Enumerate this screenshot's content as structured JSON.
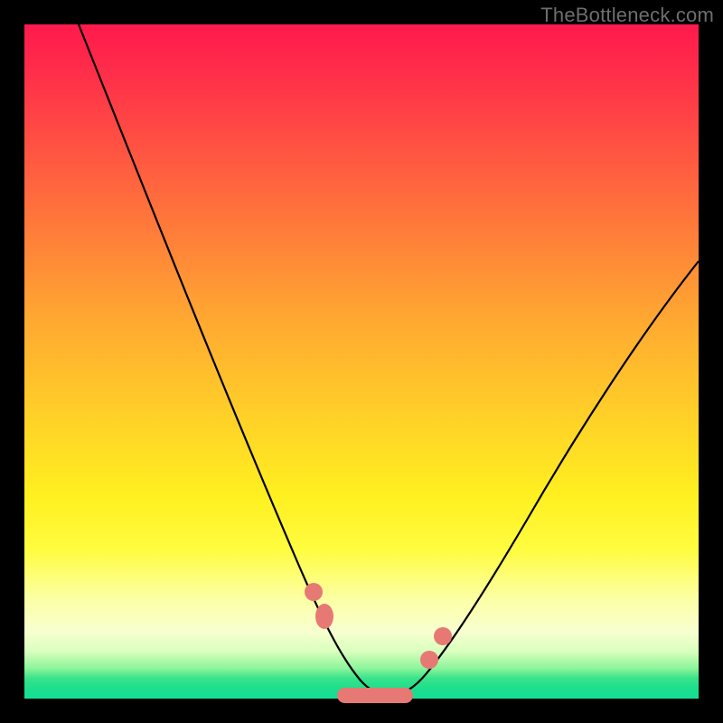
{
  "watermark": "TheBottleneck.com",
  "chart_data": {
    "type": "line",
    "title": "",
    "xlabel": "",
    "ylabel": "",
    "xlim": [
      0,
      100
    ],
    "ylim": [
      0,
      100
    ],
    "grid": false,
    "legend": false,
    "series": [
      {
        "name": "bottleneck-curve",
        "x": [
          8,
          12,
          16,
          20,
          24,
          28,
          32,
          36,
          40,
          43,
          46,
          48,
          50,
          52,
          54,
          56,
          59,
          62,
          66,
          70,
          75,
          80,
          86,
          92,
          98
        ],
        "values": [
          100,
          91,
          82,
          72,
          63,
          53,
          44,
          34,
          25,
          17,
          10,
          5,
          2,
          0,
          0,
          1,
          4,
          9,
          15,
          22,
          30,
          38,
          47,
          56,
          64
        ]
      }
    ],
    "markers": [
      {
        "name": "left-upper-dot",
        "x": 43.0,
        "y": 15.5
      },
      {
        "name": "left-lower-dot",
        "x": 44.5,
        "y": 12.0
      },
      {
        "name": "right-lower-dot",
        "x": 60.0,
        "y": 5.5
      },
      {
        "name": "right-upper-dot",
        "x": 62.0,
        "y": 9.0
      },
      {
        "name": "bottom-bar",
        "x": 52.0,
        "y": 0.5,
        "w": 11.0
      }
    ],
    "marker_color": "#e77974"
  }
}
